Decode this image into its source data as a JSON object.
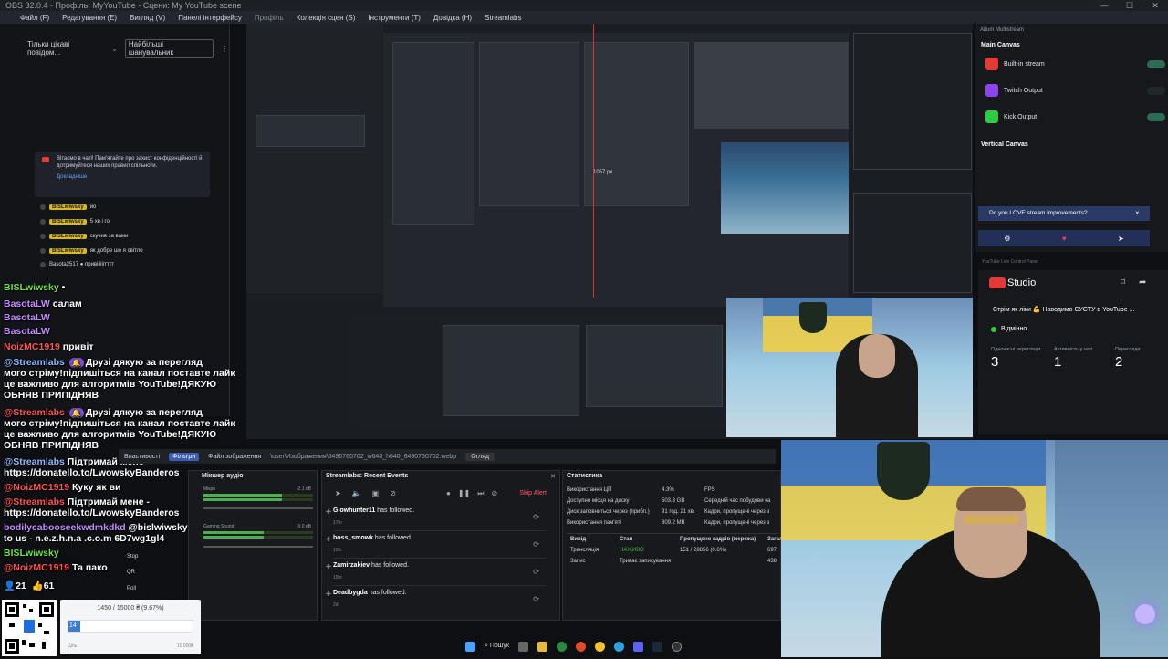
{
  "window": {
    "title": "OBS 32.0.4 - Профіль: MyYouTube - Сцени: My YouTube scene"
  },
  "menu": [
    "Файл (F)",
    "Редагування (E)",
    "Вигляд (V)",
    "Панелі інтерфейсу",
    "Профіль",
    "Колекція сцен (S)",
    "Інструменти (T)",
    "Довідка (H)",
    "Streamlabs"
  ],
  "chat": {
    "header_left": "Тільки цікаві повідом...",
    "header_right": "Найбільші шанувальник",
    "notice_text": "Вітаємо в чаті! Пам'ятайте про захист конфіденційності й дотримуйтеся наших правил спільноти.",
    "notice_more": "Докладніше",
    "messages": [
      {
        "nick": "BISLwiwsky",
        "text": "йо"
      },
      {
        "nick": "BISLwiwsky",
        "text": "5 хв і го"
      },
      {
        "nick": "BISLwiwsky",
        "text": "скучив за вами"
      },
      {
        "nick": "BISLwiwsky",
        "text": "як добре шо я світло"
      }
    ],
    "bas_line": "Basota2517 ● привіііііітттт"
  },
  "overlay": {
    "lines": [
      {
        "nick": "BISLwiwsky",
        "text": "•"
      },
      {
        "nick": "BasotaLW",
        "text": "салам"
      },
      {
        "nick": "BasotaLW",
        "text": ""
      },
      {
        "nick": "BasotaLW",
        "text": ""
      },
      {
        "nick": "NoizMC1919",
        "text": "привіт"
      },
      {
        "nick": "@Streamlabs",
        "text": "Друзі дякую за перегляд"
      },
      {
        "nick": "",
        "text": "мого стріму!підпишіться на канал поставте лайк"
      },
      {
        "nick": "",
        "text": "це важливо для алгоритмів YouTube!ДЯКУЮ"
      },
      {
        "nick": "",
        "text": "ОБНЯВ ПРИПІДНЯВ"
      },
      {
        "nick": "@Streamlabs",
        "text": "Друзі дякую за перегляд"
      },
      {
        "nick": "",
        "text": "мого стріму!підпишіться на канал поставте лайк"
      },
      {
        "nick": "",
        "text": "це важливо для алгоритмів YouTube!ДЯКУЮ"
      },
      {
        "nick": "",
        "text": "ОБНЯВ ПРИПІДНЯВ"
      },
      {
        "nick": "@Streamlabs",
        "text": "Підтримай мене -"
      },
      {
        "nick": "",
        "text": "https://donatello.to/LwowskyBanderos"
      },
      {
        "nick": "@NoizMC1919",
        "text": "Куку як ви"
      },
      {
        "nick": "@Streamlabs",
        "text": "Підтримай мене -"
      },
      {
        "nick": "",
        "text": "https://donatello.to/LwowskyBanderos"
      },
      {
        "nick": "bodilycabooseekwdmkdkd",
        "text": "@bislwiwsky come"
      },
      {
        "nick": "",
        "text": "to us - n.e.z.h.n.a .c.o.m 6D7wg1gl4"
      },
      {
        "nick": "BISLwiwsky",
        "text": ""
      },
      {
        "nick": "@NoizMC1919",
        "text": "Та пако"
      }
    ],
    "viewers": "21",
    "likes": "61"
  },
  "multistream": {
    "title": "Aitum Multistream",
    "main_canvas": "Main Canvas",
    "outputs": [
      {
        "name": "Built-in stream",
        "color": "#e53935"
      },
      {
        "name": "Twitch Output",
        "color": "#8e44ec"
      },
      {
        "name": "Kick Output",
        "color": "#2ecc40"
      }
    ],
    "vertical_canvas": "Vertical Canvas",
    "prompt": "Do you LOVE stream improvements?",
    "close": "×"
  },
  "studio": {
    "header": "YouTube Live Control Panel",
    "logo": "Studio",
    "stream_title": "Стрім як ліки 💪 Наводимо СУЄТУ в YouTube ...",
    "status": "Відмінно",
    "stats": [
      {
        "label": "Одночасні перегляди",
        "value": "3"
      },
      {
        "label": "Активність у чаті",
        "value": "1"
      },
      {
        "label": "Перегляди",
        "value": "2"
      }
    ]
  },
  "bottom_bar": {
    "items": [
      "Властивості",
      "Фільтри",
      "Файл зображення",
      "\\user\\Изображения\\6490760702_w640_h640_6490760702.webp",
      "Огляд"
    ]
  },
  "mixer": {
    "title": "Мікшер аудіо",
    "tracks": [
      {
        "name": "Мікро",
        "db": "-2.1 dB",
        "level": 0.72
      },
      {
        "name": "Gaming Sound",
        "db": "0.0 dB",
        "level": 0.55
      }
    ],
    "sources": [
      "Stop",
      "QR",
      "Poll"
    ]
  },
  "events": {
    "title": "Streamlabs: Recent Events",
    "skip": "Skip Alert",
    "items": [
      {
        "user": "Glowhunter11",
        "action": "has followed.",
        "time": "17hr"
      },
      {
        "user": "boss_smowk",
        "action": "has followed.",
        "time": "19hr"
      },
      {
        "user": "Zamirzakiev",
        "action": "has followed.",
        "time": "19hr"
      },
      {
        "user": "Deadbygda",
        "action": "has followed.",
        "time": "2d"
      }
    ]
  },
  "stats": {
    "title": "Статистика",
    "rows": [
      {
        "label": "Використання ЦП",
        "value": "4.3%"
      },
      {
        "label": "Доступно місця на диску",
        "value": "503.3 GB"
      },
      {
        "label": "Диск заповниться через (прибл.)",
        "value": "91 год. 21 хв."
      },
      {
        "label": "Використання пам'яті",
        "value": "809.2 MB"
      }
    ],
    "right_rows": [
      "FPS",
      "Середній час побудови ка",
      "Кадри, пропущені через з",
      "Кадри, пропущені через з"
    ],
    "output_headers": [
      "Вивід",
      "Стан",
      "Пропущено кадрів (мережа)",
      "Загалом"
    ],
    "outputs": [
      {
        "name": "Трансляція",
        "state": "НАЖИВО",
        "dropped": "151 / 28856 (0.6%)",
        "total": "697"
      },
      {
        "name": "Запис",
        "state": "Триває записування",
        "dropped": "",
        "total": "438"
      }
    ]
  },
  "donation": {
    "progress_text": "1450 / 15000 ₴ (9.67%)",
    "progress": 0.0967,
    "badge": "14",
    "min": "Ціль",
    "max": "15 000₴"
  },
  "taskbar": {
    "search": "Пошук"
  },
  "nested": {
    "badge": "1057 px"
  }
}
